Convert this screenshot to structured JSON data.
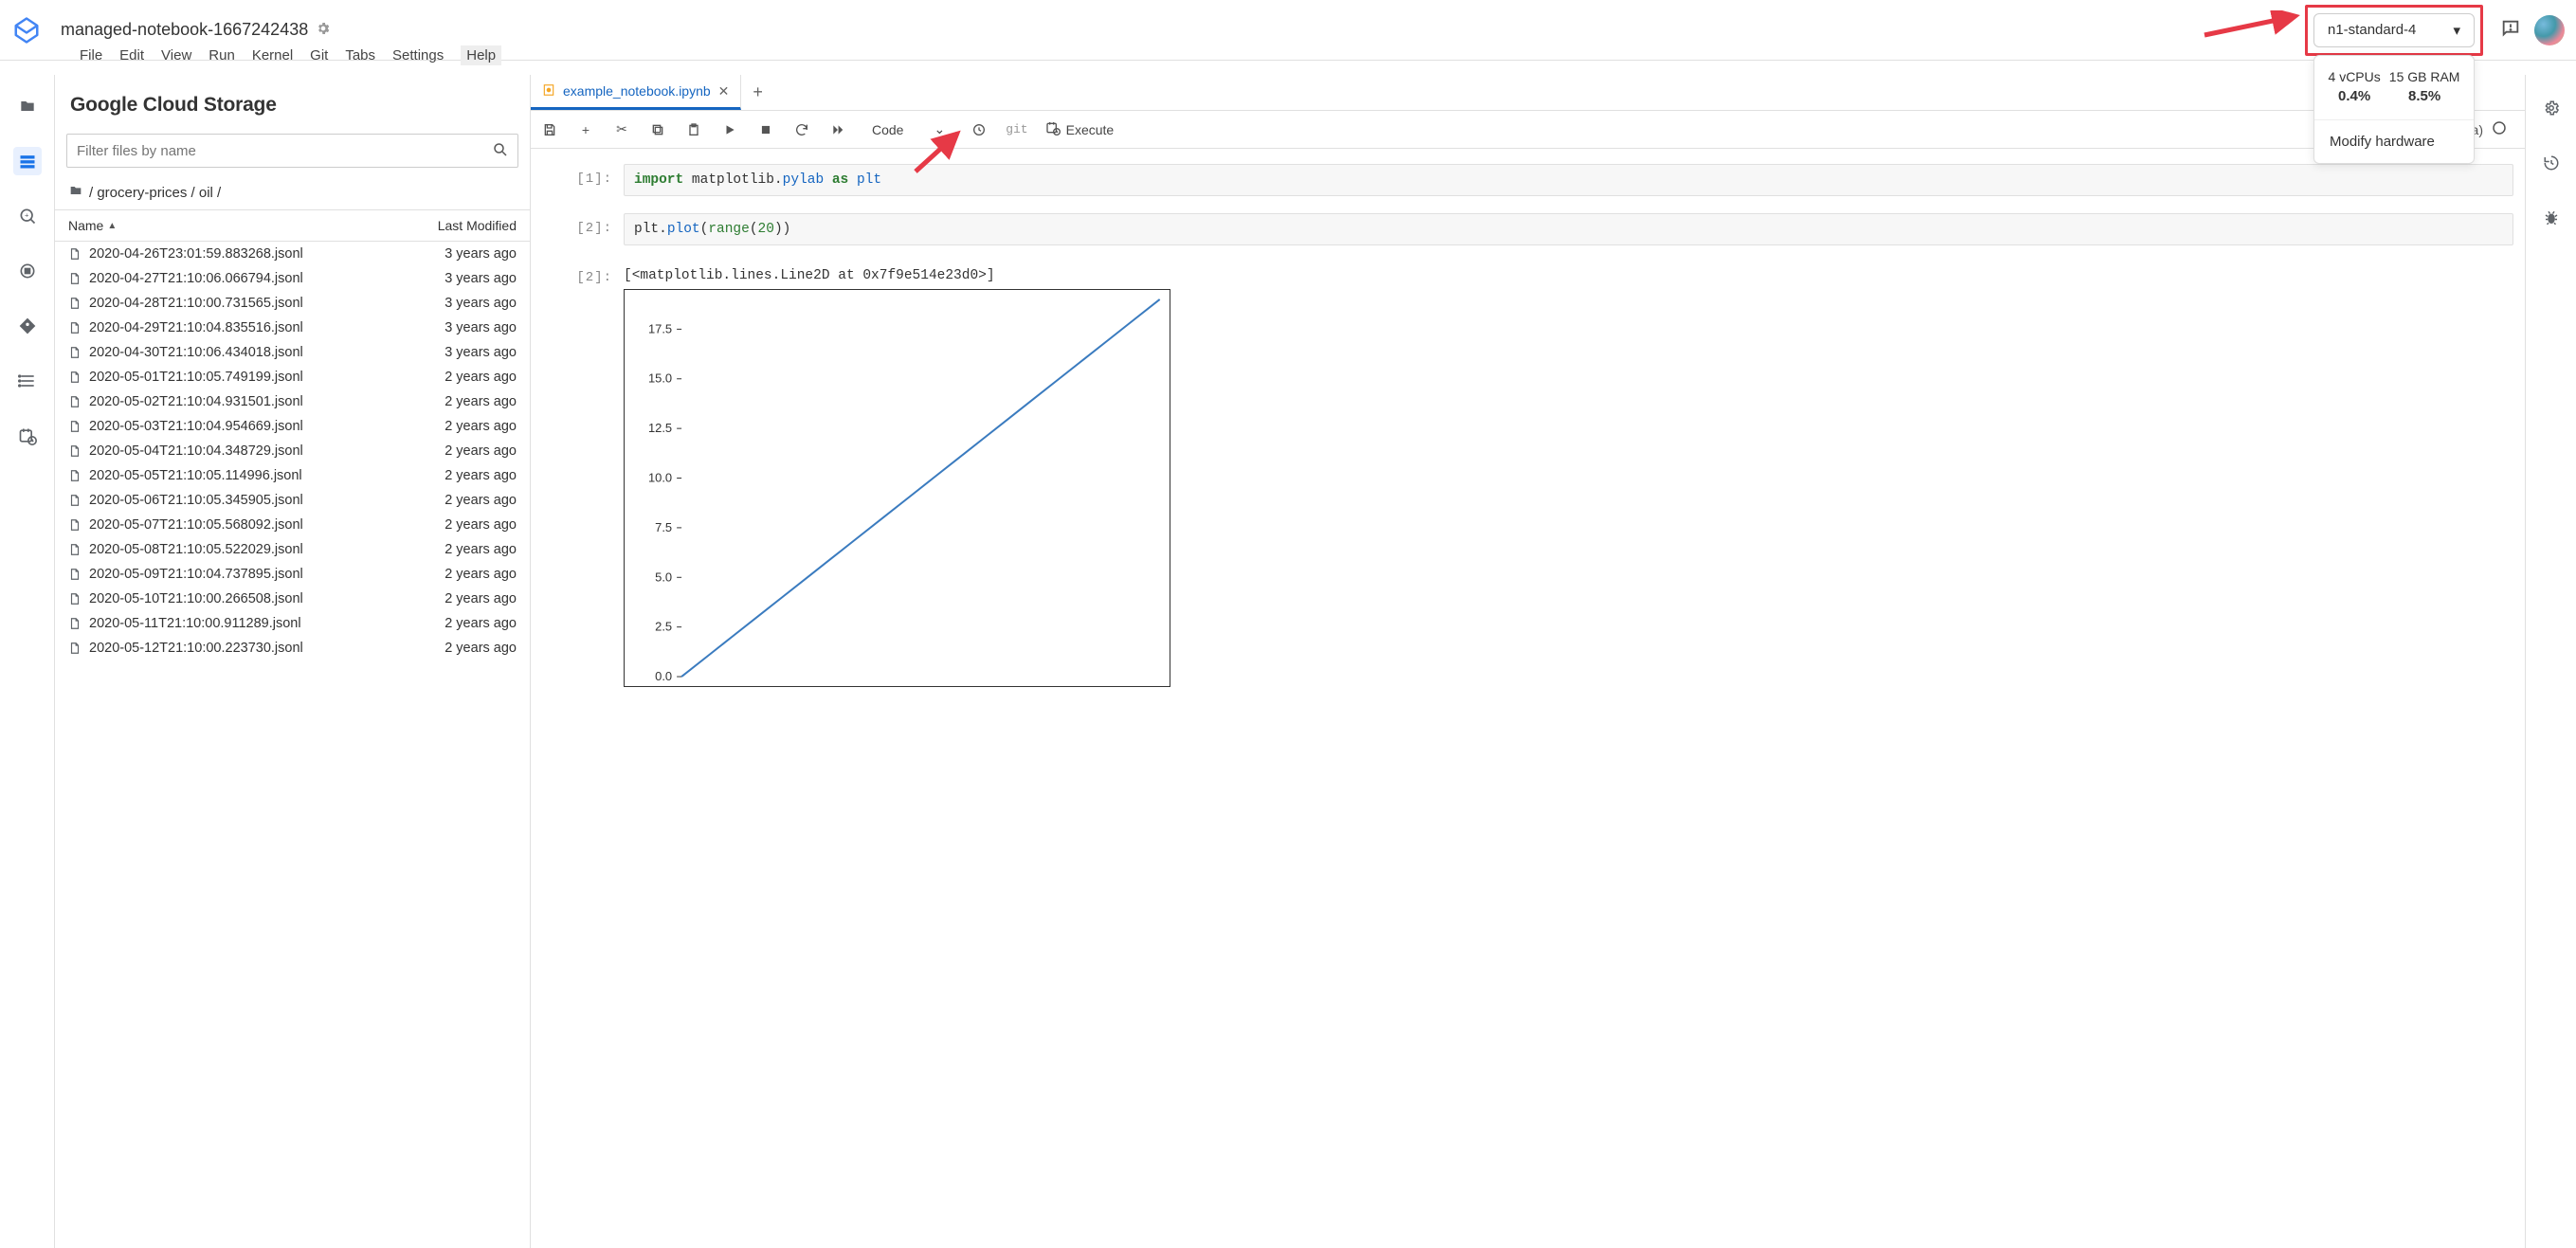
{
  "header": {
    "title": "managed-notebook-1667242438",
    "hardware": {
      "machine_type": "n1-standard-4",
      "cpu_label": "4 vCPUs",
      "cpu_pct": "0.4%",
      "ram_label": "15 GB RAM",
      "ram_pct": "8.5%",
      "modify_label": "Modify hardware"
    }
  },
  "menus": {
    "file": "File",
    "edit": "Edit",
    "view": "View",
    "run": "Run",
    "kernel": "Kernel",
    "git": "Git",
    "tabs": "Tabs",
    "settings": "Settings",
    "help": "Help"
  },
  "filepanel": {
    "title": "Google Cloud Storage",
    "filter_placeholder": "Filter files by name",
    "breadcrumb": "/ grocery-prices / oil /",
    "col_name": "Name",
    "col_modified": "Last Modified",
    "files": [
      {
        "name": "2020-04-26T23:01:59.883268.jsonl",
        "modified": "3 years ago"
      },
      {
        "name": "2020-04-27T21:10:06.066794.jsonl",
        "modified": "3 years ago"
      },
      {
        "name": "2020-04-28T21:10:00.731565.jsonl",
        "modified": "3 years ago"
      },
      {
        "name": "2020-04-29T21:10:04.835516.jsonl",
        "modified": "3 years ago"
      },
      {
        "name": "2020-04-30T21:10:06.434018.jsonl",
        "modified": "3 years ago"
      },
      {
        "name": "2020-05-01T21:10:05.749199.jsonl",
        "modified": "2 years ago"
      },
      {
        "name": "2020-05-02T21:10:04.931501.jsonl",
        "modified": "2 years ago"
      },
      {
        "name": "2020-05-03T21:10:04.954669.jsonl",
        "modified": "2 years ago"
      },
      {
        "name": "2020-05-04T21:10:04.348729.jsonl",
        "modified": "2 years ago"
      },
      {
        "name": "2020-05-05T21:10:05.114996.jsonl",
        "modified": "2 years ago"
      },
      {
        "name": "2020-05-06T21:10:05.345905.jsonl",
        "modified": "2 years ago"
      },
      {
        "name": "2020-05-07T21:10:05.568092.jsonl",
        "modified": "2 years ago"
      },
      {
        "name": "2020-05-08T21:10:05.522029.jsonl",
        "modified": "2 years ago"
      },
      {
        "name": "2020-05-09T21:10:04.737895.jsonl",
        "modified": "2 years ago"
      },
      {
        "name": "2020-05-10T21:10:00.266508.jsonl",
        "modified": "2 years ago"
      },
      {
        "name": "2020-05-11T21:10:00.911289.jsonl",
        "modified": "2 years ago"
      },
      {
        "name": "2020-05-12T21:10:00.223730.jsonl",
        "modified": "2 years ago"
      }
    ]
  },
  "notebook": {
    "tab_name": "example_notebook.ipynb",
    "toolbar": {
      "celltype": "Code",
      "git": "git",
      "execute": "Execute",
      "trailing_text": "ca)"
    },
    "cells": [
      {
        "in_prompt": "[1]:",
        "code_html": "<span class='tok-kw'>import</span> matplotlib.<span class='tok-mod2'>pylab</span> <span class='tok-kw2'>as</span> <span class='tok-mod'>plt</span>"
      },
      {
        "in_prompt": "[2]:",
        "code_html": "plt.<span class='tok-fn'>plot</span>(<span class='tok-bi'>range</span>(<span class='tok-num'>20</span>))"
      }
    ],
    "out_prompt": "[2]:",
    "out_text": "[<matplotlib.lines.Line2D at 0x7f9e514e23d0>]"
  },
  "chart_data": {
    "type": "line",
    "x": [
      0,
      1,
      2,
      3,
      4,
      5,
      6,
      7,
      8,
      9,
      10,
      11,
      12,
      13,
      14,
      15,
      16,
      17,
      18,
      19
    ],
    "y": [
      0,
      1,
      2,
      3,
      4,
      5,
      6,
      7,
      8,
      9,
      10,
      11,
      12,
      13,
      14,
      15,
      16,
      17,
      18,
      19
    ],
    "y_ticks": [
      0.0,
      2.5,
      5.0,
      7.5,
      10.0,
      12.5,
      15.0,
      17.5
    ],
    "xlim": [
      0,
      19
    ],
    "ylim": [
      0,
      19
    ],
    "series_color": "#3a7bbf"
  }
}
